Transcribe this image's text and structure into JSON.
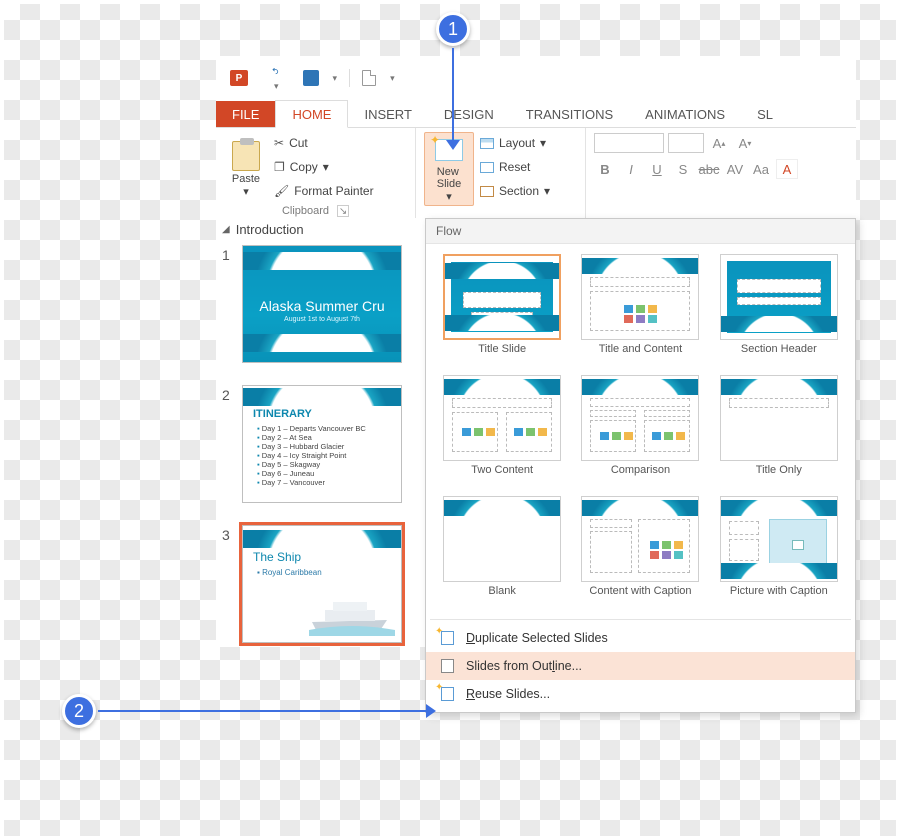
{
  "annotations": {
    "step1": "1",
    "step2": "2"
  },
  "tabs": {
    "file": "FILE",
    "home": "HOME",
    "insert": "INSERT",
    "design": "DESIGN",
    "transitions": "TRANSITIONS",
    "animations": "ANIMATIONS",
    "slideshow_trunc": "SL"
  },
  "ribbon": {
    "clipboard": {
      "label": "Clipboard",
      "paste": "Paste",
      "cut": "Cut",
      "copy": "Copy",
      "format_painter": "Format Painter"
    },
    "slides": {
      "new_slide": "New\nSlide",
      "layout": "Layout",
      "reset": "Reset",
      "section": "Section"
    },
    "font": {
      "bold": "B",
      "italic": "I",
      "underline": "U",
      "shadow": "S",
      "strike": "abc",
      "spacing": "AV",
      "case": "Aa",
      "clear": "A"
    }
  },
  "outline": {
    "section": "Introduction",
    "slides": [
      {
        "num": "1",
        "title": "Alaska Summer Cru",
        "subtitle": "August 1st to August 7th"
      },
      {
        "num": "2",
        "heading": "ITINERARY",
        "items": [
          "Day 1 – Departs Vancouver BC",
          "Day 2 – At Sea",
          "Day 3 – Hubbard Glacier",
          "Day 4 – Icy Straight Point",
          "Day 5 – Skagway",
          "Day 6 – Juneau",
          "Day 7 – Vancouver"
        ]
      },
      {
        "num": "3",
        "heading": "The Ship",
        "bullet": "Royal Caribbean"
      }
    ]
  },
  "gallery": {
    "theme": "Flow",
    "layouts": [
      "Title Slide",
      "Title and Content",
      "Section Header",
      "Two Content",
      "Comparison",
      "Title Only",
      "Blank",
      "Content with Caption",
      "Picture with Caption"
    ],
    "menu": {
      "duplicate": "Duplicate Selected Slides",
      "from_outline": "Slides from Outline...",
      "reuse": "Reuse Slides..."
    }
  }
}
